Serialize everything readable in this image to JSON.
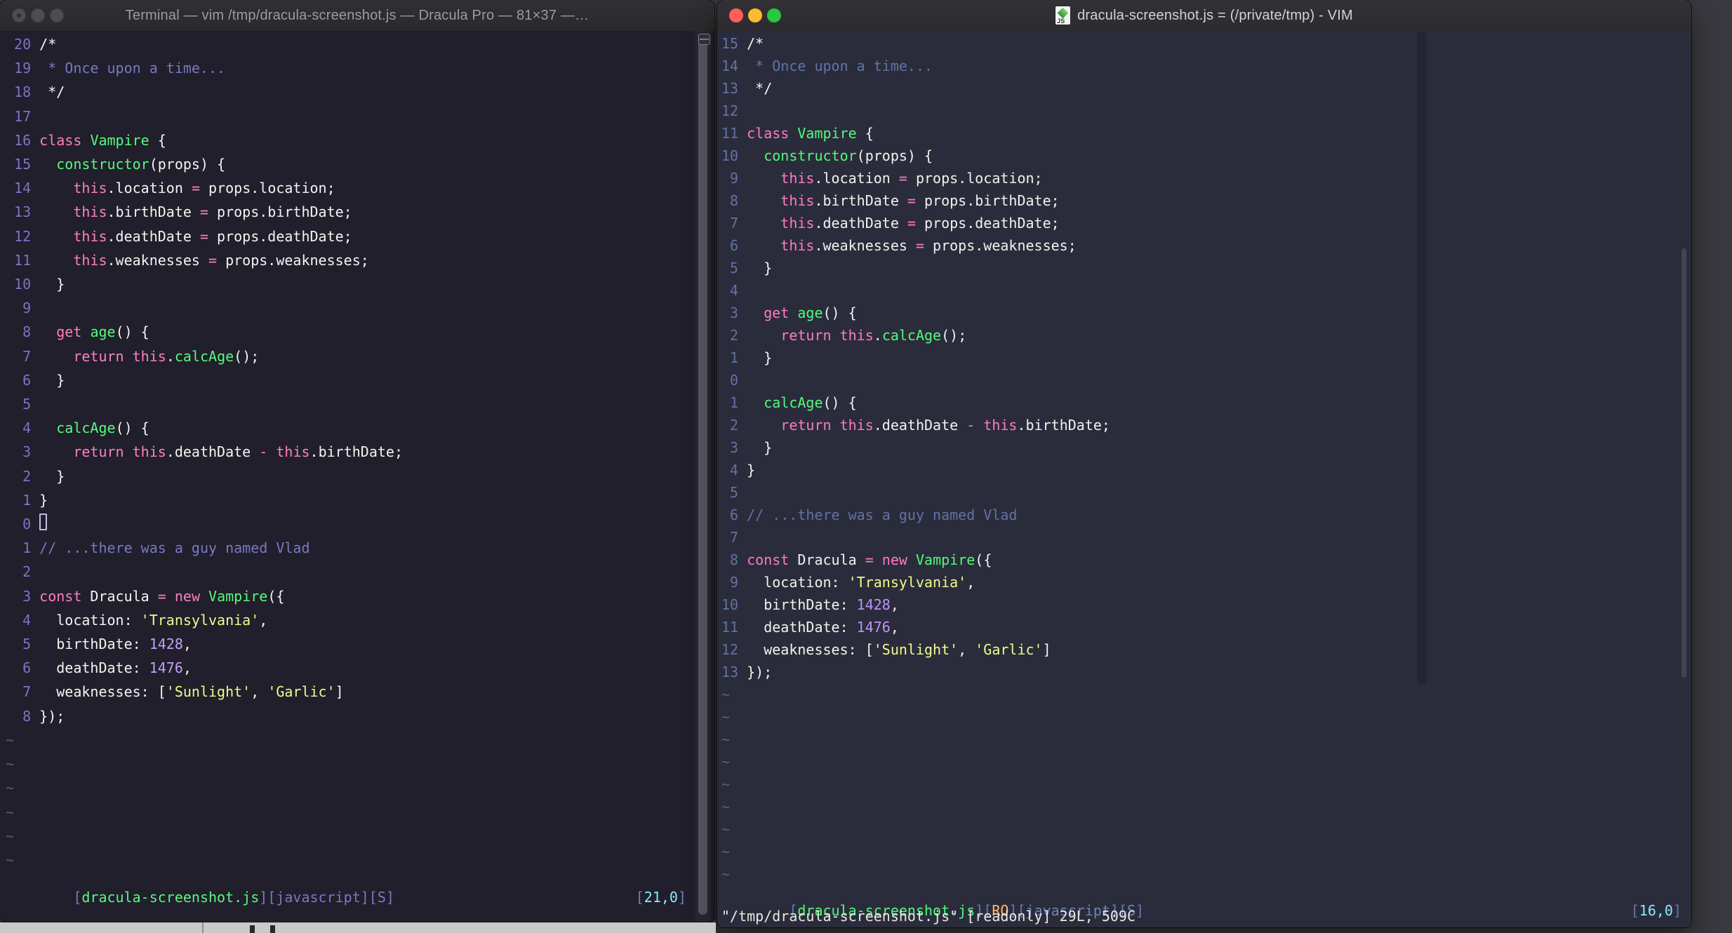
{
  "left_window": {
    "title": "Terminal — vim /tmp/dracula-screenshot.js — Dracula Pro — 81×37 —…",
    "palette": {
      "bg": "#201f2b",
      "fg": "#f5f4f0",
      "ln": "#7d73c8",
      "com": "#7a78c2",
      "kw": "#ff80bf",
      "fn": "#58f97e",
      "str": "#f1f98c",
      "num": "#bfa1f7",
      "tilde": "#5c5a6e",
      "cur": "#c2bde8",
      "b": "#7b78c4",
      "lab": "#7b78c4",
      "g": "#57f97e",
      "c": "#8be9fd",
      "msg": "#f5f4f0"
    },
    "rows": [
      [
        [
          "ln",
          " 20 "
        ],
        [
          "fg",
          "/*"
        ]
      ],
      [
        [
          "ln",
          " 19 "
        ],
        [
          "com",
          " * Once upon a time..."
        ]
      ],
      [
        [
          "ln",
          " 18 "
        ],
        [
          "fg",
          " */"
        ]
      ],
      [
        [
          "ln",
          " 17 "
        ]
      ],
      [
        [
          "ln",
          " 16 "
        ],
        [
          "kw",
          "class"
        ],
        [
          "fg",
          " "
        ],
        [
          "fn",
          "Vampire"
        ],
        [
          "fg",
          " {"
        ]
      ],
      [
        [
          "ln",
          " 15 "
        ],
        [
          "fg",
          "  "
        ],
        [
          "fn",
          "constructor"
        ],
        [
          "fg",
          "(props) {"
        ]
      ],
      [
        [
          "ln",
          " 14 "
        ],
        [
          "fg",
          "    "
        ],
        [
          "kw",
          "this"
        ],
        [
          "fg",
          ".location "
        ],
        [
          "kw",
          "="
        ],
        [
          "fg",
          " props.location;"
        ]
      ],
      [
        [
          "ln",
          " 13 "
        ],
        [
          "fg",
          "    "
        ],
        [
          "kw",
          "this"
        ],
        [
          "fg",
          ".birthDate "
        ],
        [
          "kw",
          "="
        ],
        [
          "fg",
          " props.birthDate;"
        ]
      ],
      [
        [
          "ln",
          " 12 "
        ],
        [
          "fg",
          "    "
        ],
        [
          "kw",
          "this"
        ],
        [
          "fg",
          ".deathDate "
        ],
        [
          "kw",
          "="
        ],
        [
          "fg",
          " props.deathDate;"
        ]
      ],
      [
        [
          "ln",
          " 11 "
        ],
        [
          "fg",
          "    "
        ],
        [
          "kw",
          "this"
        ],
        [
          "fg",
          ".weaknesses "
        ],
        [
          "kw",
          "="
        ],
        [
          "fg",
          " props.weaknesses;"
        ]
      ],
      [
        [
          "ln",
          " 10 "
        ],
        [
          "fg",
          "  }"
        ]
      ],
      [
        [
          "ln",
          "  9 "
        ]
      ],
      [
        [
          "ln",
          "  8 "
        ],
        [
          "fg",
          "  "
        ],
        [
          "kw",
          "get"
        ],
        [
          "fg",
          " "
        ],
        [
          "fn",
          "age"
        ],
        [
          "fg",
          "() {"
        ]
      ],
      [
        [
          "ln",
          "  7 "
        ],
        [
          "fg",
          "    "
        ],
        [
          "kw",
          "return"
        ],
        [
          "fg",
          " "
        ],
        [
          "kw",
          "this"
        ],
        [
          "fg",
          "."
        ],
        [
          "fn",
          "calcAge"
        ],
        [
          "fg",
          "();"
        ]
      ],
      [
        [
          "ln",
          "  6 "
        ],
        [
          "fg",
          "  }"
        ]
      ],
      [
        [
          "ln",
          "  5 "
        ]
      ],
      [
        [
          "ln",
          "  4 "
        ],
        [
          "fg",
          "  "
        ],
        [
          "fn",
          "calcAge"
        ],
        [
          "fg",
          "() {"
        ]
      ],
      [
        [
          "ln",
          "  3 "
        ],
        [
          "fg",
          "    "
        ],
        [
          "kw",
          "return"
        ],
        [
          "fg",
          " "
        ],
        [
          "kw",
          "this"
        ],
        [
          "fg",
          ".deathDate "
        ],
        [
          "kw",
          "-"
        ],
        [
          "fg",
          " "
        ],
        [
          "kw",
          "this"
        ],
        [
          "fg",
          ".birthDate;"
        ]
      ],
      [
        [
          "ln",
          "  2 "
        ],
        [
          "fg",
          "  }"
        ]
      ],
      [
        [
          "ln",
          "  1 "
        ],
        [
          "fg",
          "}"
        ]
      ],
      [
        [
          "ln",
          "  0 "
        ],
        [
          "cur",
          " "
        ]
      ],
      [
        [
          "ln",
          "  1 "
        ],
        [
          "com",
          "// ...there was a guy named Vlad"
        ]
      ],
      [
        [
          "ln",
          "  2 "
        ]
      ],
      [
        [
          "ln",
          "  3 "
        ],
        [
          "kw",
          "const"
        ],
        [
          "fg",
          " Dracula "
        ],
        [
          "kw",
          "="
        ],
        [
          "fg",
          " "
        ],
        [
          "kw",
          "new"
        ],
        [
          "fg",
          " "
        ],
        [
          "fn",
          "Vampire"
        ],
        [
          "fg",
          "({"
        ]
      ],
      [
        [
          "ln",
          "  4 "
        ],
        [
          "fg",
          "  location: "
        ],
        [
          "str",
          "'Transylvania'"
        ],
        [
          "fg",
          ","
        ]
      ],
      [
        [
          "ln",
          "  5 "
        ],
        [
          "fg",
          "  birthDate: "
        ],
        [
          "num",
          "1428"
        ],
        [
          "fg",
          ","
        ]
      ],
      [
        [
          "ln",
          "  6 "
        ],
        [
          "fg",
          "  deathDate: "
        ],
        [
          "num",
          "1476"
        ],
        [
          "fg",
          ","
        ]
      ],
      [
        [
          "ln",
          "  7 "
        ],
        [
          "fg",
          "  weaknesses: ["
        ],
        [
          "str",
          "'Sunlight'"
        ],
        [
          "fg",
          ", "
        ],
        [
          "str",
          "'Garlic'"
        ],
        [
          "fg",
          "]"
        ]
      ],
      [
        [
          "ln",
          "  8 "
        ],
        [
          "fg",
          "});"
        ]
      ],
      [
        [
          "tilde",
          "~"
        ]
      ],
      [
        [
          "tilde",
          "~"
        ]
      ],
      [
        [
          "tilde",
          "~"
        ]
      ],
      [
        [
          "tilde",
          "~"
        ]
      ],
      [
        [
          "tilde",
          "~"
        ]
      ],
      [
        [
          "tilde",
          "~"
        ]
      ]
    ],
    "status_tokens": [
      [
        "b",
        "["
      ],
      [
        "g",
        "dracula-screenshot.js"
      ],
      [
        "b",
        "]["
      ],
      [
        "lab",
        "javascript"
      ],
      [
        "b",
        "]["
      ],
      [
        "lab",
        "S"
      ],
      [
        "b",
        "]"
      ]
    ],
    "ruler_tokens": [
      [
        "b",
        "["
      ],
      [
        "c",
        "21,0"
      ],
      [
        "b",
        "]"
      ]
    ]
  },
  "right_window": {
    "title": "dracula-screenshot.js = (/private/tmp) - VIM",
    "icon_label": "JS",
    "palette": {
      "bg": "#2b2c3b",
      "fg": "#f3f2ee",
      "ln": "#6272a4",
      "com": "#6272a4",
      "kw": "#ff79c6",
      "fn": "#50fa7b",
      "str": "#f1fa8c",
      "num": "#bd93f9",
      "tilde": "#5a6078",
      "cur": "#f8f8f2",
      "ccol": "#242532",
      "b": "#6177b5",
      "lab": "#6c82bd",
      "g": "#50fa7b",
      "o": "#ffb86c",
      "c": "#8be9fd",
      "msg": "#e9e9e4"
    },
    "rows": [
      [
        [
          "ln",
          "15 "
        ],
        [
          "fg",
          "/*"
        ]
      ],
      [
        [
          "ln",
          "14 "
        ],
        [
          "com",
          " * Once upon a time..."
        ]
      ],
      [
        [
          "ln",
          "13 "
        ],
        [
          "fg",
          " */"
        ]
      ],
      [
        [
          "ln",
          "12 "
        ]
      ],
      [
        [
          "ln",
          "11 "
        ],
        [
          "kw",
          "class"
        ],
        [
          "fg",
          " "
        ],
        [
          "fn",
          "Vampire"
        ],
        [
          "fg",
          " {"
        ]
      ],
      [
        [
          "ln",
          "10 "
        ],
        [
          "fg",
          "  "
        ],
        [
          "fn",
          "constructor"
        ],
        [
          "fg",
          "(props) {"
        ]
      ],
      [
        [
          "ln",
          " 9 "
        ],
        [
          "fg",
          "    "
        ],
        [
          "kw",
          "this"
        ],
        [
          "fg",
          ".location "
        ],
        [
          "kw",
          "="
        ],
        [
          "fg",
          " props.location;"
        ]
      ],
      [
        [
          "ln",
          " 8 "
        ],
        [
          "fg",
          "    "
        ],
        [
          "kw",
          "this"
        ],
        [
          "fg",
          ".birthDate "
        ],
        [
          "kw",
          "="
        ],
        [
          "fg",
          " props.birthDate;"
        ]
      ],
      [
        [
          "ln",
          " 7 "
        ],
        [
          "fg",
          "    "
        ],
        [
          "kw",
          "this"
        ],
        [
          "fg",
          ".deathDate "
        ],
        [
          "kw",
          "="
        ],
        [
          "fg",
          " props.deathDate;"
        ]
      ],
      [
        [
          "ln",
          " 6 "
        ],
        [
          "fg",
          "    "
        ],
        [
          "kw",
          "this"
        ],
        [
          "fg",
          ".weaknesses "
        ],
        [
          "kw",
          "="
        ],
        [
          "fg",
          " props.weaknesses;"
        ]
      ],
      [
        [
          "ln",
          " 5 "
        ],
        [
          "fg",
          "  }"
        ]
      ],
      [
        [
          "ln",
          " 4 "
        ]
      ],
      [
        [
          "ln",
          " 3 "
        ],
        [
          "fg",
          "  "
        ],
        [
          "kw",
          "get"
        ],
        [
          "fg",
          " "
        ],
        [
          "fn",
          "age"
        ],
        [
          "fg",
          "() {"
        ]
      ],
      [
        [
          "ln",
          " 2 "
        ],
        [
          "fg",
          "    "
        ],
        [
          "kw",
          "return"
        ],
        [
          "fg",
          " "
        ],
        [
          "kw",
          "this"
        ],
        [
          "fg",
          "."
        ],
        [
          "fn",
          "calcAge"
        ],
        [
          "fg",
          "();"
        ]
      ],
      [
        [
          "ln",
          " 1 "
        ],
        [
          "fg",
          "  }"
        ]
      ],
      [
        [
          "ln",
          " 0 "
        ]
      ],
      [
        [
          "ln",
          " 1 "
        ],
        [
          "fg",
          "  "
        ],
        [
          "fn",
          "calcAge"
        ],
        [
          "fg",
          "() {"
        ]
      ],
      [
        [
          "ln",
          " 2 "
        ],
        [
          "fg",
          "    "
        ],
        [
          "kw",
          "return"
        ],
        [
          "fg",
          " "
        ],
        [
          "kw",
          "this"
        ],
        [
          "fg",
          ".deathDate "
        ],
        [
          "kw",
          "-"
        ],
        [
          "fg",
          " "
        ],
        [
          "kw",
          "this"
        ],
        [
          "fg",
          ".birthDate;"
        ]
      ],
      [
        [
          "ln",
          " 3 "
        ],
        [
          "fg",
          "  }"
        ]
      ],
      [
        [
          "ln",
          " 4 "
        ],
        [
          "fg",
          "}"
        ]
      ],
      [
        [
          "ln",
          " 5 "
        ]
      ],
      [
        [
          "ln",
          " 6 "
        ],
        [
          "com",
          "// ...there was a guy named Vlad"
        ]
      ],
      [
        [
          "ln",
          " 7 "
        ]
      ],
      [
        [
          "ln",
          " 8 "
        ],
        [
          "kw",
          "const"
        ],
        [
          "fg",
          " Dracula "
        ],
        [
          "kw",
          "="
        ],
        [
          "fg",
          " "
        ],
        [
          "kw",
          "new"
        ],
        [
          "fg",
          " "
        ],
        [
          "fn",
          "Vampire"
        ],
        [
          "fg",
          "({"
        ]
      ],
      [
        [
          "ln",
          " 9 "
        ],
        [
          "fg",
          "  location: "
        ],
        [
          "str",
          "'Transylvania'"
        ],
        [
          "fg",
          ","
        ]
      ],
      [
        [
          "ln",
          "10 "
        ],
        [
          "fg",
          "  birthDate: "
        ],
        [
          "num",
          "1428"
        ],
        [
          "fg",
          ","
        ]
      ],
      [
        [
          "ln",
          "11 "
        ],
        [
          "fg",
          "  deathDate: "
        ],
        [
          "num",
          "1476"
        ],
        [
          "fg",
          ","
        ]
      ],
      [
        [
          "ln",
          "12 "
        ],
        [
          "fg",
          "  weaknesses: ["
        ],
        [
          "str",
          "'Sunlight'"
        ],
        [
          "fg",
          ", "
        ],
        [
          "str",
          "'Garlic'"
        ],
        [
          "fg",
          "]"
        ]
      ],
      [
        [
          "ln",
          "13 "
        ],
        [
          "fg",
          "});"
        ]
      ],
      [
        [
          "tilde",
          "~"
        ]
      ],
      [
        [
          "tilde",
          "~"
        ]
      ],
      [
        [
          "tilde",
          "~"
        ]
      ],
      [
        [
          "tilde",
          "~"
        ]
      ],
      [
        [
          "tilde",
          "~"
        ]
      ],
      [
        [
          "tilde",
          "~"
        ]
      ],
      [
        [
          "tilde",
          "~"
        ]
      ],
      [
        [
          "tilde",
          "~"
        ]
      ],
      [
        [
          "tilde",
          "~"
        ]
      ]
    ],
    "status_tokens": [
      [
        "b",
        "["
      ],
      [
        "g",
        "dracula-screenshot.js"
      ],
      [
        "b",
        "]["
      ],
      [
        "o",
        "RO"
      ],
      [
        "b",
        "]["
      ],
      [
        "lab",
        "javascript"
      ],
      [
        "b",
        "]["
      ],
      [
        "lab",
        "S"
      ],
      [
        "b",
        "]"
      ]
    ],
    "ruler_tokens": [
      [
        "b",
        "["
      ],
      [
        "c",
        "16,0"
      ],
      [
        "b",
        "]"
      ]
    ],
    "message": "\"/tmp/dracula-screenshot.js\" [readonly] 29L, 509C"
  }
}
